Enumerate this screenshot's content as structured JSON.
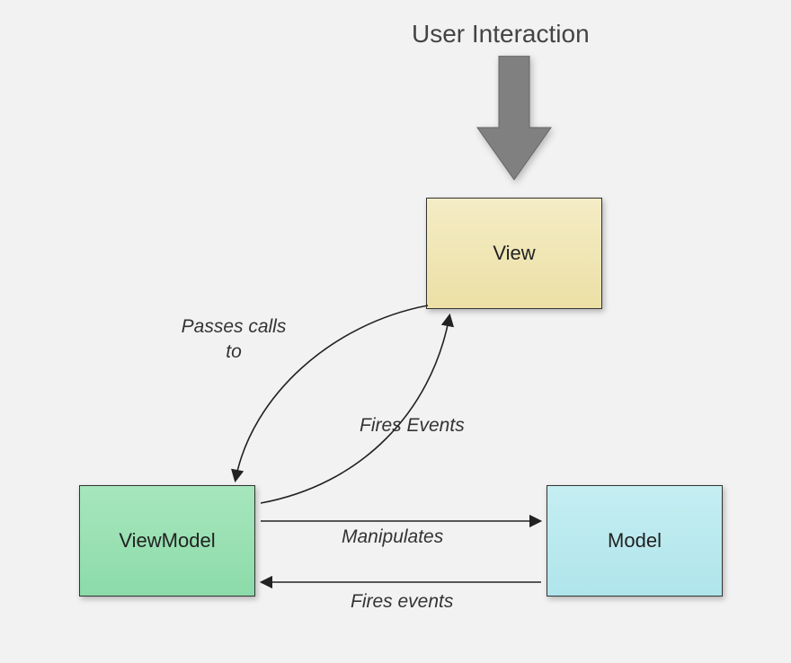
{
  "title": "User Interaction",
  "boxes": {
    "view": "View",
    "viewmodel": "ViewModel",
    "model": "Model"
  },
  "labels": {
    "passes_calls_to": "Passes calls to",
    "fires_events_top": "Fires Events",
    "manipulates": "Manipulates",
    "fires_events_bottom": "Fires events"
  },
  "colors": {
    "view_fill": "#ece0a6",
    "viewmodel_fill": "#8cdba9",
    "model_fill": "#afe5eb",
    "arrow_fill": "#808080",
    "background": "#f2f2f2"
  }
}
